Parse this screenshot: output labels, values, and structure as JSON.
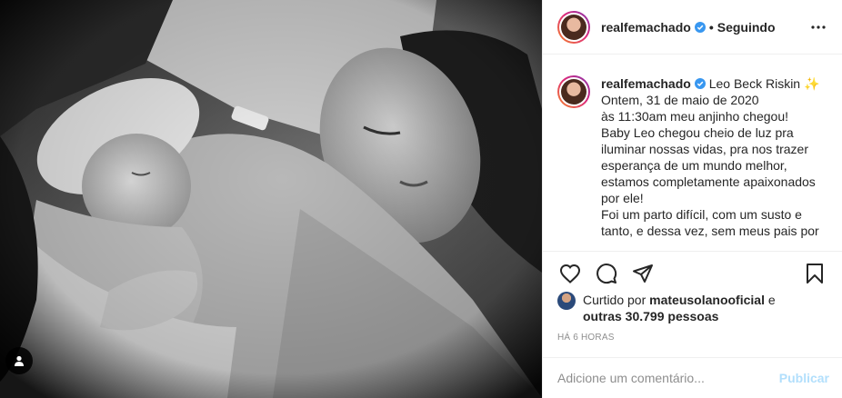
{
  "post": {
    "username": "realfemachado",
    "verified": true,
    "separator": "•",
    "follow_status": "Seguindo"
  },
  "caption": {
    "username": "realfemachado",
    "lines": [
      "Leo Beck Riskin ✨",
      "Ontem, 31 de maio de 2020",
      "às 11:30am meu anjinho chegou!",
      "Baby Leo chegou cheio de luz pra",
      "iluminar nossas vidas, pra nos trazer",
      "esperança de um mundo melhor,",
      "estamos completamente apaixonados",
      "por ele!",
      "Foi um parto difícil, com um susto e",
      "tanto, e dessa vez, sem meus pais por"
    ]
  },
  "likes": {
    "prefix": "Curtido por",
    "user": "mateusolanooficial",
    "joiner": "e",
    "others": "outras 30.799 pessoas"
  },
  "time_ago": "HÁ 6 HORAS",
  "comment": {
    "placeholder": "Adicione um comentário...",
    "post_label": "Publicar"
  },
  "icons": {
    "like": "heart-icon",
    "comment": "comment-icon",
    "share": "paper-plane-icon",
    "save": "bookmark-icon",
    "more": "more-horizontal-icon",
    "verified": "verified-badge-icon",
    "user_tag": "user-tag-icon"
  },
  "colors": {
    "verified_blue": "#3897f0",
    "post_button_disabled": "#b2dffc",
    "muted_text": "#8e8e8e"
  }
}
